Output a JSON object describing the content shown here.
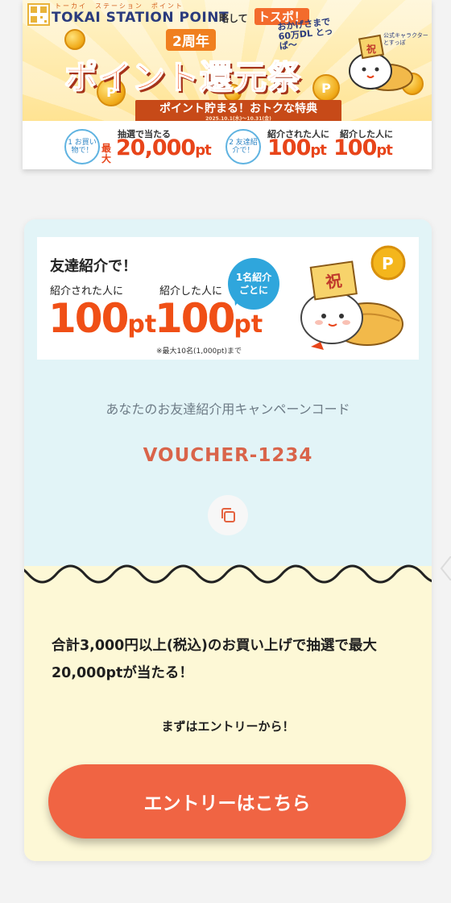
{
  "banner": {
    "logo_ruby": "トーカイ　ステーション　ポイント",
    "logo": "TOKAI STATION POINT",
    "logo_sub": "略して",
    "logo_tospo": "トスポ！",
    "anniversary": "2周年",
    "title": "ポイント還元祭",
    "ribbon": "ポイント貯まる！おトクな特典",
    "ribbon_date": "2025.10.1(水)〜10.31(金)",
    "dl_bubble": "おかげさまで 60万DL とっぱ〜",
    "mascot_tag": "公式キャラクター とすっぽ",
    "offer1_circle": "1 お買い物で！",
    "offer1_label": "抽選で当たる",
    "offer1_max": "最大",
    "offer1_value": "20,000",
    "offer1_unit": "pt",
    "offer2_circle": "2 友達紹介で！",
    "offer2_label": "紹介された人に",
    "offer2_value": "100",
    "offer2_unit": "pt",
    "offer3_label": "紹介した人に",
    "offer3_value": "100",
    "offer3_unit": "pt",
    "hat_char": "祝",
    "coin_char": "P"
  },
  "invite": {
    "title": "友達紹介で！",
    "referred_label": "紹介された人に",
    "referrer_label": "紹介した人に",
    "referred_value": "100",
    "referrer_value": "100",
    "unit": "pt",
    "bubble_line1": "1名紹介",
    "bubble_line2": "ごとに",
    "note": "※最大10名(1,000pt)まで",
    "hat_char": "祝",
    "coin_char": "P"
  },
  "code": {
    "caption": "あなたのお友達紹介用キャンペーンコード",
    "value": "VOUCHER-1234",
    "copy_icon": "copy-icon"
  },
  "lottery": {
    "text": "合計3,000円以上(税込)のお買い上げで抽選で最大20,000ptが当たる！",
    "entry_caption": "まずはエントリーから！",
    "entry_button": "エントリーはこちら"
  },
  "colors": {
    "accent_orange": "#f06443",
    "code_red": "#d9644a",
    "card_blue": "#e2f4f7",
    "card_yellow": "#fdf8d6"
  }
}
